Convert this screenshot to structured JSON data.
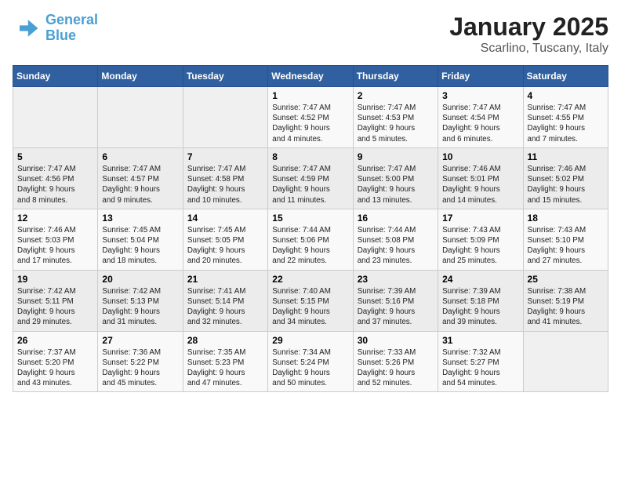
{
  "logo": {
    "line1": "General",
    "line2": "Blue"
  },
  "title": "January 2025",
  "subtitle": "Scarlino, Tuscany, Italy",
  "days_of_week": [
    "Sunday",
    "Monday",
    "Tuesday",
    "Wednesday",
    "Thursday",
    "Friday",
    "Saturday"
  ],
  "weeks": [
    [
      {
        "day": "",
        "info": ""
      },
      {
        "day": "",
        "info": ""
      },
      {
        "day": "",
        "info": ""
      },
      {
        "day": "1",
        "info": "Sunrise: 7:47 AM\nSunset: 4:52 PM\nDaylight: 9 hours\nand 4 minutes."
      },
      {
        "day": "2",
        "info": "Sunrise: 7:47 AM\nSunset: 4:53 PM\nDaylight: 9 hours\nand 5 minutes."
      },
      {
        "day": "3",
        "info": "Sunrise: 7:47 AM\nSunset: 4:54 PM\nDaylight: 9 hours\nand 6 minutes."
      },
      {
        "day": "4",
        "info": "Sunrise: 7:47 AM\nSunset: 4:55 PM\nDaylight: 9 hours\nand 7 minutes."
      }
    ],
    [
      {
        "day": "5",
        "info": "Sunrise: 7:47 AM\nSunset: 4:56 PM\nDaylight: 9 hours\nand 8 minutes."
      },
      {
        "day": "6",
        "info": "Sunrise: 7:47 AM\nSunset: 4:57 PM\nDaylight: 9 hours\nand 9 minutes."
      },
      {
        "day": "7",
        "info": "Sunrise: 7:47 AM\nSunset: 4:58 PM\nDaylight: 9 hours\nand 10 minutes."
      },
      {
        "day": "8",
        "info": "Sunrise: 7:47 AM\nSunset: 4:59 PM\nDaylight: 9 hours\nand 11 minutes."
      },
      {
        "day": "9",
        "info": "Sunrise: 7:47 AM\nSunset: 5:00 PM\nDaylight: 9 hours\nand 13 minutes."
      },
      {
        "day": "10",
        "info": "Sunrise: 7:46 AM\nSunset: 5:01 PM\nDaylight: 9 hours\nand 14 minutes."
      },
      {
        "day": "11",
        "info": "Sunrise: 7:46 AM\nSunset: 5:02 PM\nDaylight: 9 hours\nand 15 minutes."
      }
    ],
    [
      {
        "day": "12",
        "info": "Sunrise: 7:46 AM\nSunset: 5:03 PM\nDaylight: 9 hours\nand 17 minutes."
      },
      {
        "day": "13",
        "info": "Sunrise: 7:45 AM\nSunset: 5:04 PM\nDaylight: 9 hours\nand 18 minutes."
      },
      {
        "day": "14",
        "info": "Sunrise: 7:45 AM\nSunset: 5:05 PM\nDaylight: 9 hours\nand 20 minutes."
      },
      {
        "day": "15",
        "info": "Sunrise: 7:44 AM\nSunset: 5:06 PM\nDaylight: 9 hours\nand 22 minutes."
      },
      {
        "day": "16",
        "info": "Sunrise: 7:44 AM\nSunset: 5:08 PM\nDaylight: 9 hours\nand 23 minutes."
      },
      {
        "day": "17",
        "info": "Sunrise: 7:43 AM\nSunset: 5:09 PM\nDaylight: 9 hours\nand 25 minutes."
      },
      {
        "day": "18",
        "info": "Sunrise: 7:43 AM\nSunset: 5:10 PM\nDaylight: 9 hours\nand 27 minutes."
      }
    ],
    [
      {
        "day": "19",
        "info": "Sunrise: 7:42 AM\nSunset: 5:11 PM\nDaylight: 9 hours\nand 29 minutes."
      },
      {
        "day": "20",
        "info": "Sunrise: 7:42 AM\nSunset: 5:13 PM\nDaylight: 9 hours\nand 31 minutes."
      },
      {
        "day": "21",
        "info": "Sunrise: 7:41 AM\nSunset: 5:14 PM\nDaylight: 9 hours\nand 32 minutes."
      },
      {
        "day": "22",
        "info": "Sunrise: 7:40 AM\nSunset: 5:15 PM\nDaylight: 9 hours\nand 34 minutes."
      },
      {
        "day": "23",
        "info": "Sunrise: 7:39 AM\nSunset: 5:16 PM\nDaylight: 9 hours\nand 37 minutes."
      },
      {
        "day": "24",
        "info": "Sunrise: 7:39 AM\nSunset: 5:18 PM\nDaylight: 9 hours\nand 39 minutes."
      },
      {
        "day": "25",
        "info": "Sunrise: 7:38 AM\nSunset: 5:19 PM\nDaylight: 9 hours\nand 41 minutes."
      }
    ],
    [
      {
        "day": "26",
        "info": "Sunrise: 7:37 AM\nSunset: 5:20 PM\nDaylight: 9 hours\nand 43 minutes."
      },
      {
        "day": "27",
        "info": "Sunrise: 7:36 AM\nSunset: 5:22 PM\nDaylight: 9 hours\nand 45 minutes."
      },
      {
        "day": "28",
        "info": "Sunrise: 7:35 AM\nSunset: 5:23 PM\nDaylight: 9 hours\nand 47 minutes."
      },
      {
        "day": "29",
        "info": "Sunrise: 7:34 AM\nSunset: 5:24 PM\nDaylight: 9 hours\nand 50 minutes."
      },
      {
        "day": "30",
        "info": "Sunrise: 7:33 AM\nSunset: 5:26 PM\nDaylight: 9 hours\nand 52 minutes."
      },
      {
        "day": "31",
        "info": "Sunrise: 7:32 AM\nSunset: 5:27 PM\nDaylight: 9 hours\nand 54 minutes."
      },
      {
        "day": "",
        "info": ""
      }
    ]
  ]
}
